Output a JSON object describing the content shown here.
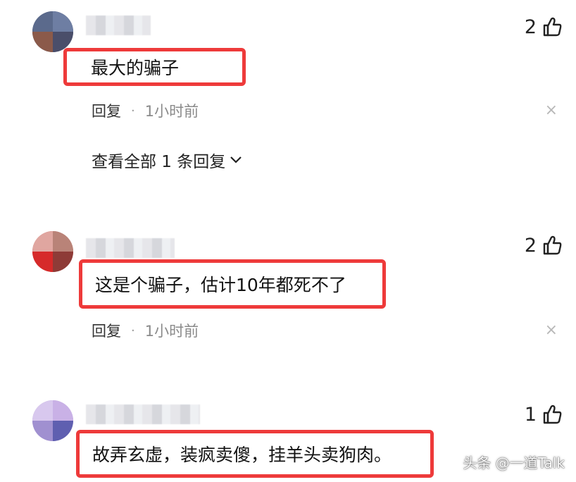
{
  "comments": [
    {
      "likes": "2",
      "text": "最大的骗子",
      "reply_label": "回复",
      "separator": "·",
      "time": "1小时前",
      "view_replies": "查看全部 1 条回复",
      "close": "×"
    },
    {
      "likes": "2",
      "text": "这是个骗子，估计10年都死不了",
      "reply_label": "回复",
      "separator": "·",
      "time": "1小时前",
      "close": "×"
    },
    {
      "likes": "1",
      "text": "故弄玄虚，装疯卖傻，挂羊头卖狗肉。"
    }
  ],
  "watermark": "头条 @一道Talk",
  "colors": {
    "highlight_border": "#ee3a3a"
  }
}
